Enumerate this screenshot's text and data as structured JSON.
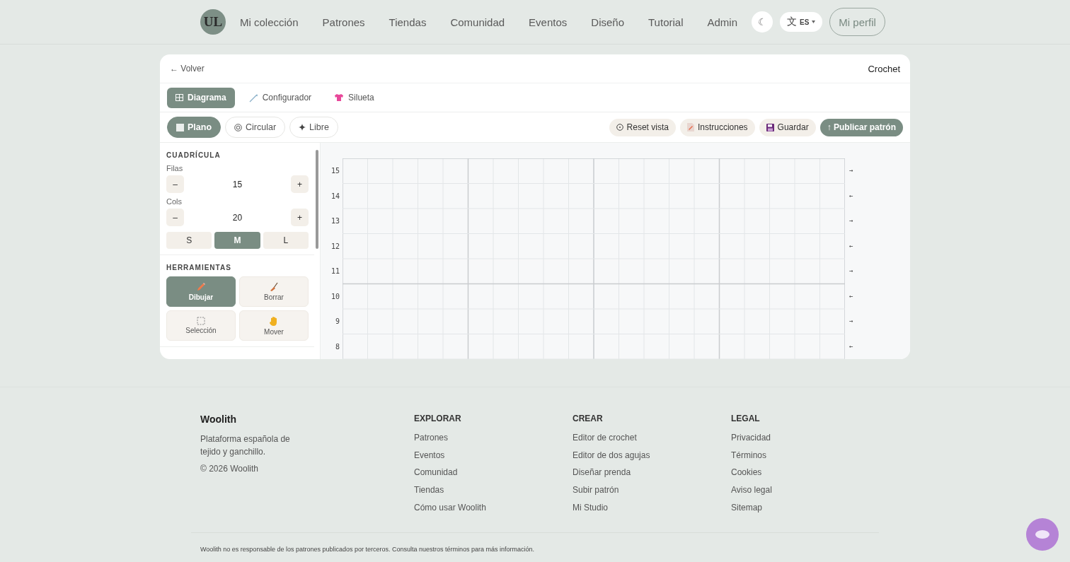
{
  "nav": {
    "logo": "UL",
    "links": [
      "Mi colección",
      "Patrones",
      "Tiendas",
      "Comunidad",
      "Eventos",
      "Diseño",
      "Tutorial",
      "Admin"
    ],
    "theme_toggle": "☾",
    "language": {
      "icon": "文",
      "code": "ES"
    },
    "profile": "Mi perfil"
  },
  "editor": {
    "back": "← Volver",
    "craft": "Crochet",
    "tabs": [
      {
        "label": "Diagrama",
        "kind": "grid",
        "selected": true
      },
      {
        "label": "Configurador",
        "kind": "hook",
        "selected": false
      },
      {
        "label": "Silueta",
        "kind": "shirt",
        "selected": false
      }
    ],
    "modes": [
      {
        "label": "Plano",
        "kind": "square",
        "selected": true
      },
      {
        "label": "Circular",
        "kind": "ring",
        "selected": false
      },
      {
        "label": "Libre",
        "kind": "star",
        "selected": false
      }
    ],
    "actions": [
      {
        "label": "Reset vista",
        "kind": "reset"
      },
      {
        "label": "Instrucciones",
        "kind": "doc"
      },
      {
        "label": "Guardar",
        "kind": "save"
      },
      {
        "label": "↑ Publicar patrón",
        "kind": "primary"
      }
    ],
    "grid_section": {
      "title": "CUADRÍCULA",
      "decrement": "–",
      "increment": "+",
      "fields": [
        {
          "label": "Filas",
          "value": "15"
        },
        {
          "label": "Cols",
          "value": "20"
        }
      ],
      "sizes": [
        {
          "label": "S",
          "selected": false
        },
        {
          "label": "M",
          "selected": true
        },
        {
          "label": "L",
          "selected": false
        }
      ]
    },
    "tools_section": {
      "title": "HERRAMIENTAS",
      "tools": [
        {
          "label": "Dibujar",
          "kind": "pencil",
          "selected": true
        },
        {
          "label": "Borrar",
          "kind": "broom",
          "selected": false
        },
        {
          "label": "Selección",
          "kind": "select",
          "selected": false
        },
        {
          "label": "Mover",
          "kind": "hand",
          "selected": false
        }
      ]
    },
    "canvas_rows": [
      {
        "label": "15",
        "arrow": "→"
      },
      {
        "label": "14",
        "arrow": "←"
      },
      {
        "label": "13",
        "arrow": "→"
      },
      {
        "label": "12",
        "arrow": "←"
      },
      {
        "label": "11",
        "arrow": "→"
      },
      {
        "label": "10",
        "arrow": "←"
      },
      {
        "label": "9",
        "arrow": "→"
      },
      {
        "label": "8",
        "arrow": "←"
      }
    ]
  },
  "footer": {
    "brand": "Woolith",
    "tagline": "Plataforma española de tejido y ganchillo.",
    "copyright": "© 2026 Woolith",
    "columns": [
      {
        "title": "EXPLORAR",
        "links": [
          "Patrones",
          "Eventos",
          "Comunidad",
          "Tiendas",
          "Cómo usar Woolith"
        ]
      },
      {
        "title": "CREAR",
        "links": [
          "Editor de crochet",
          "Editor de dos agujas",
          "Diseñar prenda",
          "Subir patrón",
          "Mi Studio"
        ]
      },
      {
        "title": "LEGAL",
        "links": [
          "Privacidad",
          "Términos",
          "Cookies",
          "Aviso legal",
          "Sitemap"
        ]
      }
    ],
    "disclaimer": "Woolith no es responsable de los patrones publicados por terceros. Consulta nuestros términos para más información."
  }
}
